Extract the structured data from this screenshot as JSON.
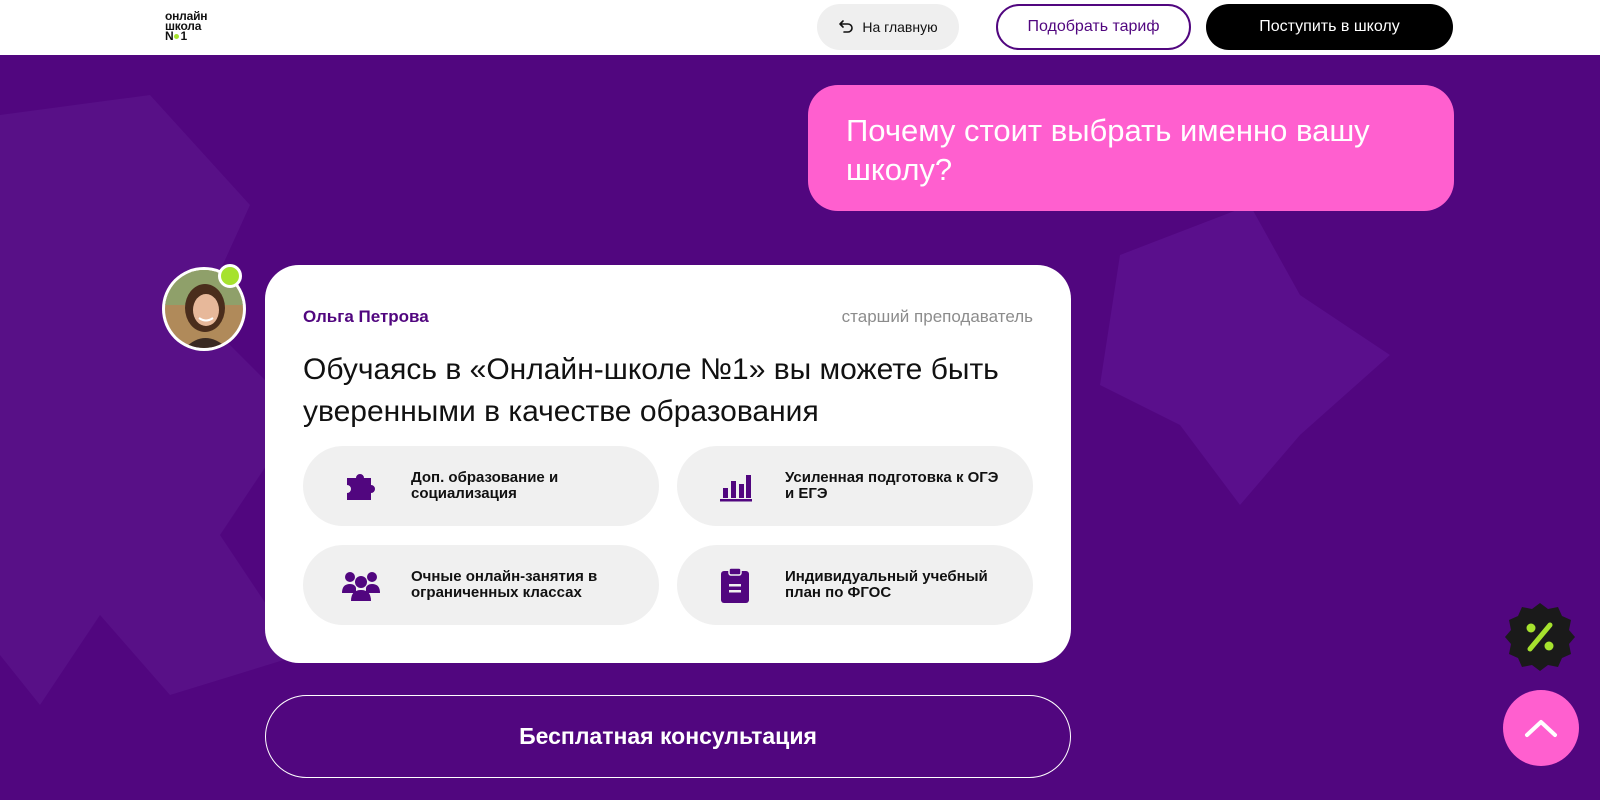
{
  "header": {
    "logo_line1": "онлайн",
    "logo_line2": "школа",
    "logo_line3_prefix": "N",
    "logo_line3_suffix": "1",
    "home_label": "На главную",
    "tariff_label": "Подобрать тариф",
    "enroll_label": "Поступить в школу"
  },
  "question": {
    "text": "Почему стоит выбрать именно вашу школу?"
  },
  "card": {
    "author": "Ольга Петрова",
    "role": "старший преподаватель",
    "headline": "Обучаясь в «Онлайн-школе №1» вы можете быть уверенными в качестве образования",
    "features": [
      {
        "icon": "puzzle-icon",
        "label": "Доп. образование и социализация"
      },
      {
        "icon": "bar-chart-icon",
        "label": "Усиленная подготовка к ОГЭ и ЕГЭ"
      },
      {
        "icon": "group-icon",
        "label": "Очные онлайн-занятия в ограниченных классах"
      },
      {
        "icon": "clipboard-icon",
        "label": "Индивидуальный учебный план по ФГОС"
      }
    ]
  },
  "consult": {
    "label": "Бесплатная консультация"
  },
  "colors": {
    "background": "#51067f",
    "accent_pink": "#ff5fcf",
    "accent_green": "#a6e22e",
    "primary_purple": "#51067f"
  }
}
